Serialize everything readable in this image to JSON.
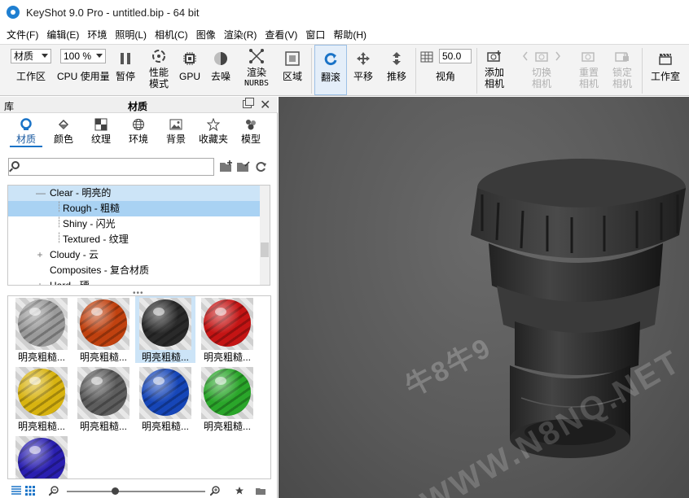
{
  "window": {
    "title": "KeyShot 9.0 Pro  - untitled.bip  - 64 bit"
  },
  "menu": [
    "文件(F)",
    "编辑(E)",
    "环境",
    "照明(L)",
    "相机(C)",
    "图像",
    "渲染(R)",
    "查看(V)",
    "窗口",
    "帮助(H)"
  ],
  "toolbar": {
    "workspace_combo": "材质",
    "workspace_label": "工作区",
    "cpu_combo": "100 %",
    "cpu_label": "CPU 使用量",
    "pause": "暂停",
    "performance_mode": "性能\n模式",
    "gpu": "GPU",
    "denoise": "去噪",
    "render_nurbs_1": "渲染",
    "render_nurbs_2": "NURBS",
    "region": "区域",
    "tumble": "翻滚",
    "pan": "平移",
    "dolly": "推移",
    "fov_value": "50.0",
    "fov_label": "视角",
    "add_camera_1": "添加",
    "add_camera_2": "相机",
    "switch_camera_1": "切换",
    "switch_camera_2": "相机",
    "reset_camera_1": "重置",
    "reset_camera_2": "相机",
    "lock_camera_1": "锁定",
    "lock_camera_2": "相机",
    "studio": "工作室"
  },
  "library": {
    "panel_label": "库",
    "panel_title": "材质",
    "tabs": [
      "材质",
      "颜色",
      "纹理",
      "环境",
      "背景",
      "收藏夹",
      "模型"
    ],
    "active_tab": "材质",
    "search_value": "",
    "tree": [
      {
        "label": "Clear - 明亮的",
        "expander": "—"
      },
      {
        "label": "Rough - 粗糙",
        "expander": ""
      },
      {
        "label": "Shiny - 闪光",
        "expander": ""
      },
      {
        "label": "Textured - 纹理",
        "expander": ""
      },
      {
        "label": "Cloudy - 云",
        "expander": "+"
      },
      {
        "label": "Composites - 复合材质",
        "expander": ""
      },
      {
        "label": "Hard - 硬",
        "expander": "+"
      }
    ],
    "splitter_glyph": "•••",
    "materials": [
      {
        "name": "明亮粗糙...",
        "color": "#9a9a9a"
      },
      {
        "name": "明亮粗糙...",
        "color": "#c0410f"
      },
      {
        "name": "明亮粗糙...",
        "color": "#2a2a2a"
      },
      {
        "name": "明亮粗糙...",
        "color": "#c41414"
      },
      {
        "name": "明亮粗糙...",
        "color": "#d8b310"
      },
      {
        "name": "明亮粗糙...",
        "color": "#5d5d5d"
      },
      {
        "name": "明亮粗糙...",
        "color": "#1646b8"
      },
      {
        "name": "明亮粗糙...",
        "color": "#2aa62a"
      },
      {
        "name": "",
        "color": "#2a1fb0"
      }
    ],
    "selected_material_index": 2
  },
  "viewport": {
    "watermark_1": "牛8牛9",
    "watermark_2": "WWW.N8NQ.NET"
  }
}
